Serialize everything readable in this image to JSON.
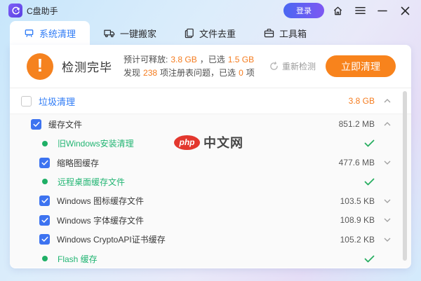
{
  "window": {
    "title": "C盘助手"
  },
  "titlebar": {
    "login_label": "登录",
    "icons": [
      "home-icon",
      "menu-icon",
      "minimize-icon",
      "close-icon"
    ]
  },
  "tabs": [
    {
      "label": "系统清理",
      "icon": "clean-icon",
      "active": true
    },
    {
      "label": "一键搬家",
      "icon": "truck-icon",
      "active": false
    },
    {
      "label": "文件去重",
      "icon": "dedupe-icon",
      "active": false
    },
    {
      "label": "工具箱",
      "icon": "toolbox-icon",
      "active": false
    }
  ],
  "status": {
    "headline": "检测完毕",
    "line1": {
      "prefix": "预计可释放:",
      "freeable": "3.8 GB",
      "mid": "，已选",
      "selected": "1.5 GB"
    },
    "line2": {
      "prefix": "发现",
      "count": "238",
      "mid": "项注册表问题，已选",
      "selected_count": "0",
      "suffix": "项"
    },
    "rescan_label": "重新检测",
    "clean_button_label": "立即清理"
  },
  "list": {
    "group": {
      "label": "垃圾清理",
      "size": "3.8 GB",
      "checked": false,
      "chevron": "up"
    },
    "rows": [
      {
        "label": "缓存文件",
        "size": "851.2 MB",
        "checked": true,
        "done": false,
        "chevron": "up"
      },
      {
        "label": "旧Windows安装清理",
        "size": "",
        "checked": null,
        "done": true,
        "chevron": null
      },
      {
        "label": "缩略图缓存",
        "size": "477.6 MB",
        "checked": true,
        "done": false,
        "chevron": "down"
      },
      {
        "label": "远程桌面缓存文件",
        "size": "",
        "checked": null,
        "done": true,
        "chevron": null
      },
      {
        "label": "Windows 图标缓存文件",
        "size": "103.5 KB",
        "checked": true,
        "done": false,
        "chevron": "down"
      },
      {
        "label": "Windows 字体缓存文件",
        "size": "108.9 KB",
        "checked": true,
        "done": false,
        "chevron": "down"
      },
      {
        "label": "Windows CryptoAPI证书缓存",
        "size": "105.2 KB",
        "checked": true,
        "done": false,
        "chevron": "down"
      },
      {
        "label": "Flash 缓存",
        "size": "",
        "checked": null,
        "done": true,
        "chevron": null
      }
    ]
  },
  "watermark": {
    "badge": "php",
    "text": "中文网"
  },
  "colors": {
    "accent_blue": "#2e7bf6",
    "accent_orange": "#f57c1f",
    "button_orange": "#f8831c",
    "success_green": "#22b573",
    "checkbox_blue": "#3d73f0",
    "logo_purple": "#6a4ff0",
    "login_gradient_start": "#4a67f2",
    "login_gradient_end": "#7e57f2"
  }
}
